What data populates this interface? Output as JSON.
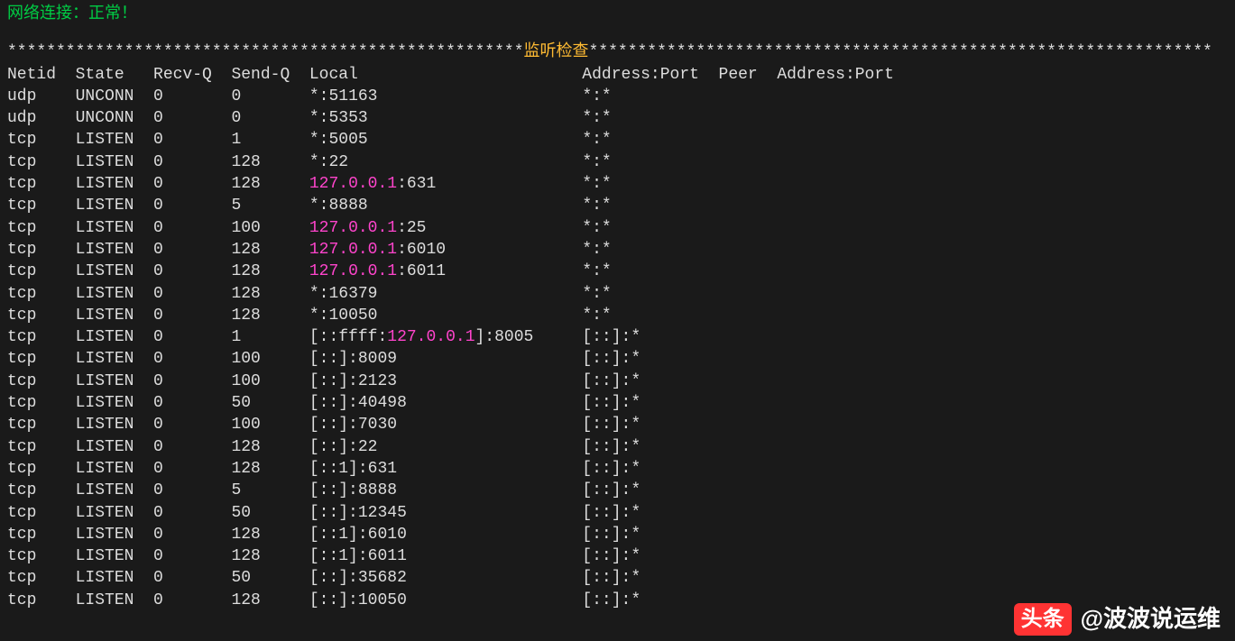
{
  "status_text": "网络连接：正常！",
  "divider": {
    "stars": "*****************************************************",
    "title": "监听检查",
    "stars_right": "****************************************************************"
  },
  "headers": {
    "netid": "Netid",
    "state": "State",
    "recvq": "Recv-Q",
    "sendq": "Send-Q",
    "local": "Local",
    "addrport": "Address:Port",
    "peer": "Peer",
    "addrport2": "Address:Port"
  },
  "rows": [
    {
      "netid": "udp",
      "state": "UNCONN",
      "recvq": "0",
      "sendq": "0",
      "local_prefix": "*:",
      "local_ip": "",
      "local_suffix": "51163",
      "peer": "*:*"
    },
    {
      "netid": "udp",
      "state": "UNCONN",
      "recvq": "0",
      "sendq": "0",
      "local_prefix": "*:",
      "local_ip": "",
      "local_suffix": "5353",
      "peer": "*:*"
    },
    {
      "netid": "tcp",
      "state": "LISTEN",
      "recvq": "0",
      "sendq": "1",
      "local_prefix": "*:",
      "local_ip": "",
      "local_suffix": "5005",
      "peer": "*:*"
    },
    {
      "netid": "tcp",
      "state": "LISTEN",
      "recvq": "0",
      "sendq": "128",
      "local_prefix": "*:",
      "local_ip": "",
      "local_suffix": "22",
      "peer": "*:*"
    },
    {
      "netid": "tcp",
      "state": "LISTEN",
      "recvq": "0",
      "sendq": "128",
      "local_prefix": "",
      "local_ip": "127.0.0.1",
      "local_suffix": ":631",
      "peer": "*:*"
    },
    {
      "netid": "tcp",
      "state": "LISTEN",
      "recvq": "0",
      "sendq": "5",
      "local_prefix": "*:",
      "local_ip": "",
      "local_suffix": "8888",
      "peer": "*:*"
    },
    {
      "netid": "tcp",
      "state": "LISTEN",
      "recvq": "0",
      "sendq": "100",
      "local_prefix": "",
      "local_ip": "127.0.0.1",
      "local_suffix": ":25",
      "peer": "*:*"
    },
    {
      "netid": "tcp",
      "state": "LISTEN",
      "recvq": "0",
      "sendq": "128",
      "local_prefix": "",
      "local_ip": "127.0.0.1",
      "local_suffix": ":6010",
      "peer": "*:*"
    },
    {
      "netid": "tcp",
      "state": "LISTEN",
      "recvq": "0",
      "sendq": "128",
      "local_prefix": "",
      "local_ip": "127.0.0.1",
      "local_suffix": ":6011",
      "peer": "*:*"
    },
    {
      "netid": "tcp",
      "state": "LISTEN",
      "recvq": "0",
      "sendq": "128",
      "local_prefix": "*:",
      "local_ip": "",
      "local_suffix": "16379",
      "peer": "*:*"
    },
    {
      "netid": "tcp",
      "state": "LISTEN",
      "recvq": "0",
      "sendq": "128",
      "local_prefix": "*:",
      "local_ip": "",
      "local_suffix": "10050",
      "peer": "*:*"
    },
    {
      "netid": "tcp",
      "state": "LISTEN",
      "recvq": "0",
      "sendq": "1",
      "local_prefix": "[::ffff:",
      "local_ip": "127.0.0.1",
      "local_suffix": "]:8005",
      "peer": "[::]:*"
    },
    {
      "netid": "tcp",
      "state": "LISTEN",
      "recvq": "0",
      "sendq": "100",
      "local_prefix": "[::]:",
      "local_ip": "",
      "local_suffix": "8009",
      "peer": "[::]:*"
    },
    {
      "netid": "tcp",
      "state": "LISTEN",
      "recvq": "0",
      "sendq": "100",
      "local_prefix": "[::]:",
      "local_ip": "",
      "local_suffix": "2123",
      "peer": "[::]:*"
    },
    {
      "netid": "tcp",
      "state": "LISTEN",
      "recvq": "0",
      "sendq": "50",
      "local_prefix": "[::]:",
      "local_ip": "",
      "local_suffix": "40498",
      "peer": "[::]:*"
    },
    {
      "netid": "tcp",
      "state": "LISTEN",
      "recvq": "0",
      "sendq": "100",
      "local_prefix": "[::]:",
      "local_ip": "",
      "local_suffix": "7030",
      "peer": "[::]:*"
    },
    {
      "netid": "tcp",
      "state": "LISTEN",
      "recvq": "0",
      "sendq": "128",
      "local_prefix": "[::]:",
      "local_ip": "",
      "local_suffix": "22",
      "peer": "[::]:*"
    },
    {
      "netid": "tcp",
      "state": "LISTEN",
      "recvq": "0",
      "sendq": "128",
      "local_prefix": "[::1]:",
      "local_ip": "",
      "local_suffix": "631",
      "peer": "[::]:*"
    },
    {
      "netid": "tcp",
      "state": "LISTEN",
      "recvq": "0",
      "sendq": "5",
      "local_prefix": "[::]:",
      "local_ip": "",
      "local_suffix": "8888",
      "peer": "[::]:*"
    },
    {
      "netid": "tcp",
      "state": "LISTEN",
      "recvq": "0",
      "sendq": "50",
      "local_prefix": "[::]:",
      "local_ip": "",
      "local_suffix": "12345",
      "peer": "[::]:*"
    },
    {
      "netid": "tcp",
      "state": "LISTEN",
      "recvq": "0",
      "sendq": "128",
      "local_prefix": "[::1]:",
      "local_ip": "",
      "local_suffix": "6010",
      "peer": "[::]:*"
    },
    {
      "netid": "tcp",
      "state": "LISTEN",
      "recvq": "0",
      "sendq": "128",
      "local_prefix": "[::1]:",
      "local_ip": "",
      "local_suffix": "6011",
      "peer": "[::]:*"
    },
    {
      "netid": "tcp",
      "state": "LISTEN",
      "recvq": "0",
      "sendq": "50",
      "local_prefix": "[::]:",
      "local_ip": "",
      "local_suffix": "35682",
      "peer": "[::]:*"
    },
    {
      "netid": "tcp",
      "state": "LISTEN",
      "recvq": "0",
      "sendq": "128",
      "local_prefix": "[::]:",
      "local_ip": "",
      "local_suffix": "10050",
      "peer": "[::]:*"
    }
  ],
  "watermark": {
    "logo": "头条",
    "text": "@波波说运维"
  },
  "cols": {
    "netid_w": 7,
    "state_w": 8,
    "recvq_w": 8,
    "sendq_w": 8,
    "local_w": 28,
    "addrport_w": 14,
    "peer_label_w_header": 6,
    "peer_w": 0
  }
}
